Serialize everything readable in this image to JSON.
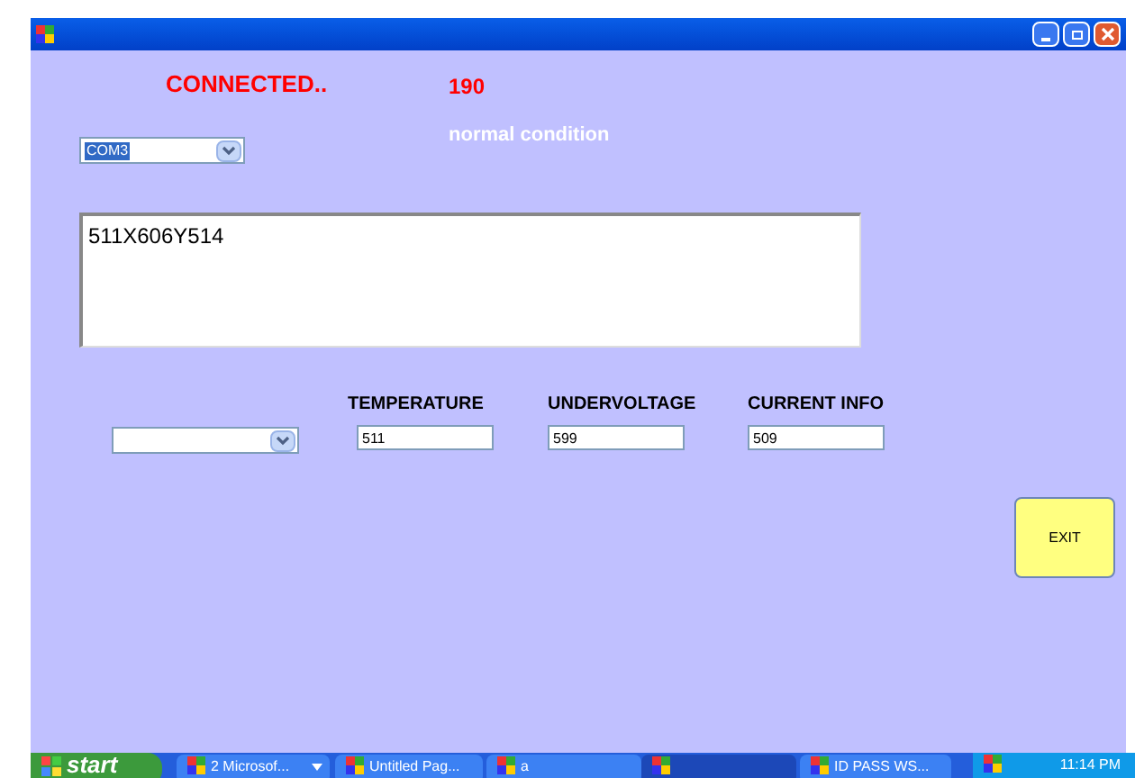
{
  "status": {
    "connection": "CONNECTED..",
    "count": "190",
    "condition": "normal condition"
  },
  "port_select": {
    "value": "COM3"
  },
  "log": {
    "value": "511X606Y514"
  },
  "readings": [
    {
      "label": "TEMPERATURE",
      "value": "511"
    },
    {
      "label": "UNDERVOLTAGE",
      "value": "599"
    },
    {
      "label": "CURRENT INFO",
      "value": "509"
    }
  ],
  "exit_button": "EXIT",
  "taskbar": {
    "start": "start",
    "items": [
      {
        "label": "2 Microsof...",
        "selected": false,
        "menu": true
      },
      {
        "label": "Untitled Pag...",
        "selected": false,
        "menu": false
      },
      {
        "label": "a",
        "selected": false,
        "menu": false
      },
      {
        "selected": true,
        "menu": false
      },
      {
        "label": "ID PASS WS...",
        "selected": false,
        "menu": false
      }
    ],
    "clock": "11:14 PM"
  }
}
